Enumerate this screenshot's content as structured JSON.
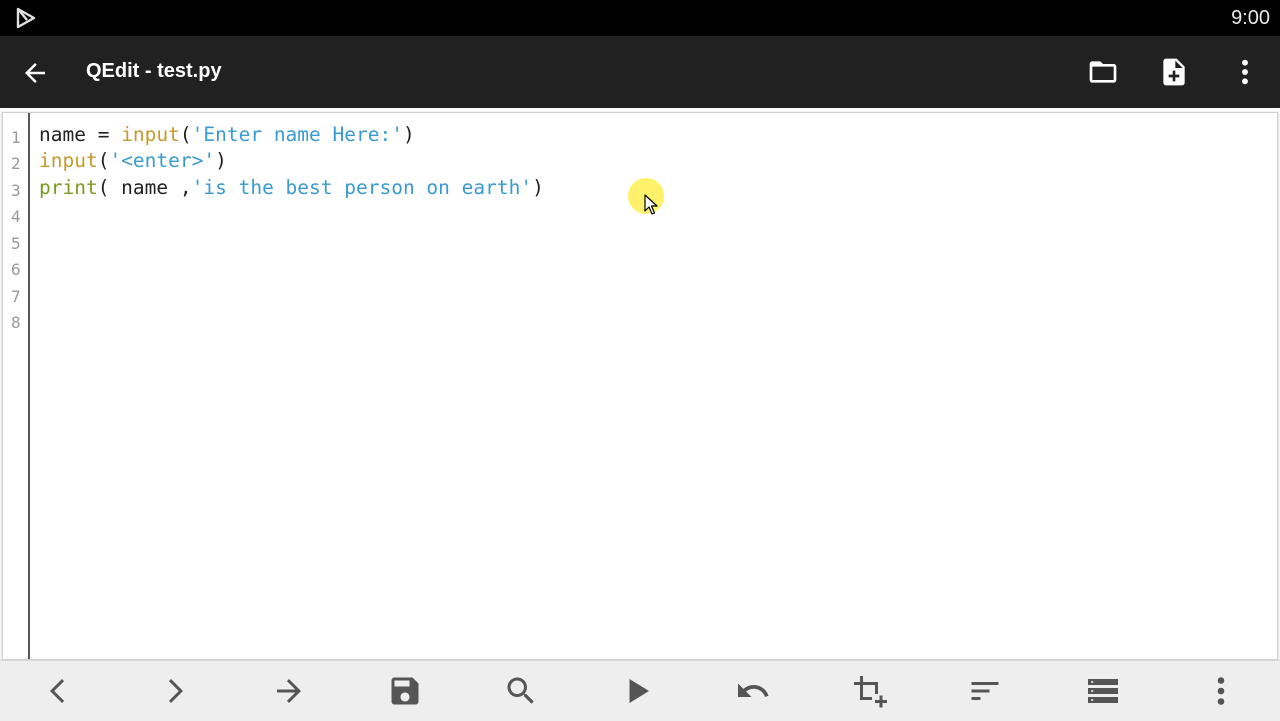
{
  "status_bar": {
    "time": "9:00",
    "notification_icon": "play-store-icon"
  },
  "app_bar": {
    "title": "QEdit - test.py",
    "back_icon": "arrow-back-icon",
    "actions": [
      "folder-open-icon",
      "new-file-icon",
      "more-vert-icon"
    ]
  },
  "editor": {
    "line_numbers": [
      "1",
      "2",
      "3",
      "4",
      "5",
      "6",
      "7",
      "8"
    ],
    "lines": [
      {
        "tokens": [
          {
            "text": "name = ",
            "kind": "plain"
          },
          {
            "text": "input",
            "kind": "builtin"
          },
          {
            "text": "(",
            "kind": "plain"
          },
          {
            "text": "'Enter name Here:'",
            "kind": "string"
          },
          {
            "text": ")",
            "kind": "plain"
          }
        ]
      },
      {
        "tokens": [
          {
            "text": "input",
            "kind": "builtin"
          },
          {
            "text": "(",
            "kind": "plain"
          },
          {
            "text": "'<enter>'",
            "kind": "string"
          },
          {
            "text": ")",
            "kind": "plain"
          }
        ]
      },
      {
        "tokens": [
          {
            "text": "print",
            "kind": "print"
          },
          {
            "text": "( name ,",
            "kind": "plain"
          },
          {
            "text": "'is the best person on earth'",
            "kind": "string"
          },
          {
            "text": ")",
            "kind": "plain"
          }
        ]
      }
    ]
  },
  "toolbar": {
    "tools": [
      "nav-left-icon",
      "nav-right-icon",
      "go-to-icon",
      "save-icon",
      "search-icon",
      "run-icon",
      "undo-icon",
      "add-selection-icon",
      "format-icon",
      "list-icon",
      "more-vert-icon"
    ]
  },
  "colors": {
    "appbar": "#212121",
    "statusbar": "#000000",
    "builtin": "#c79a2e",
    "string": "#3a9bd0",
    "print": "#7a9a1e"
  }
}
